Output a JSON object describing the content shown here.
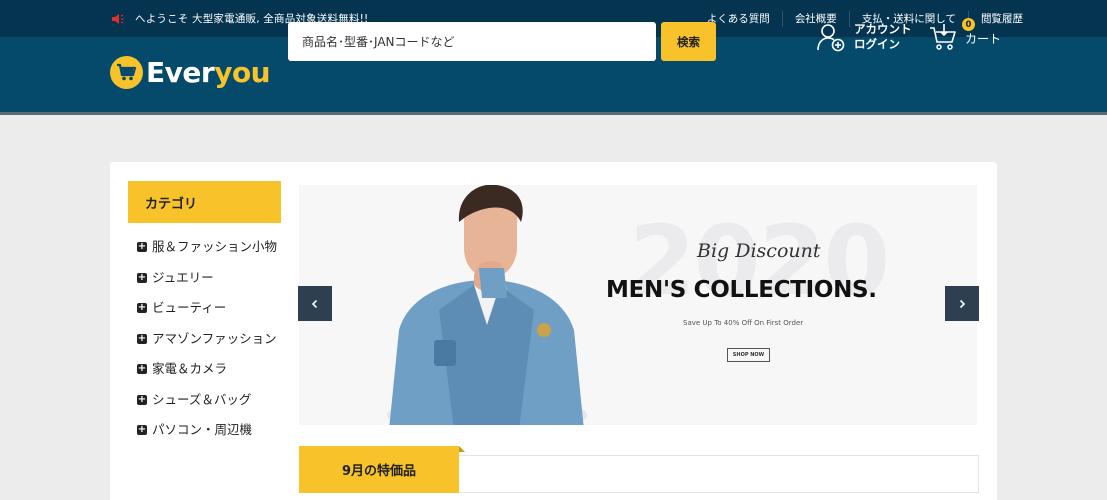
{
  "topbar": {
    "welcome": "へようこそ 大型家電通販, 全商品対象送料無料!!",
    "links": [
      "よくある質問",
      "会社概要",
      "支払・送料に関して",
      "閲覧履歴"
    ]
  },
  "header": {
    "logo_part1": "Ever",
    "logo_part2": "you",
    "search_placeholder": "商品名･型番･JANコードなど",
    "search_button": "検索",
    "account_line1": "アカウント",
    "account_line2": "ログイン",
    "cart_count": "0",
    "cart_label": "カート"
  },
  "sidebar": {
    "heading": "カテゴリ",
    "items": [
      "服＆ファッション小物",
      "ジュエリー",
      "ビューティー",
      "アマゾンファッション",
      "家電＆カメラ",
      "シューズ＆バッグ",
      "パソコン・周辺機"
    ]
  },
  "banner": {
    "year": "2020",
    "tagline": "Big Discount",
    "title": "MEN'S COLLECTIONS.",
    "subtitle": "Save Up To 40% Off On First Order",
    "cta": "SHOP NOW"
  },
  "specials": {
    "heading": "9月の特価品"
  },
  "colors": {
    "topbar": "#04344f",
    "header": "#054a6b",
    "accent": "#f7c22a",
    "arrow": "#2e3f52"
  }
}
